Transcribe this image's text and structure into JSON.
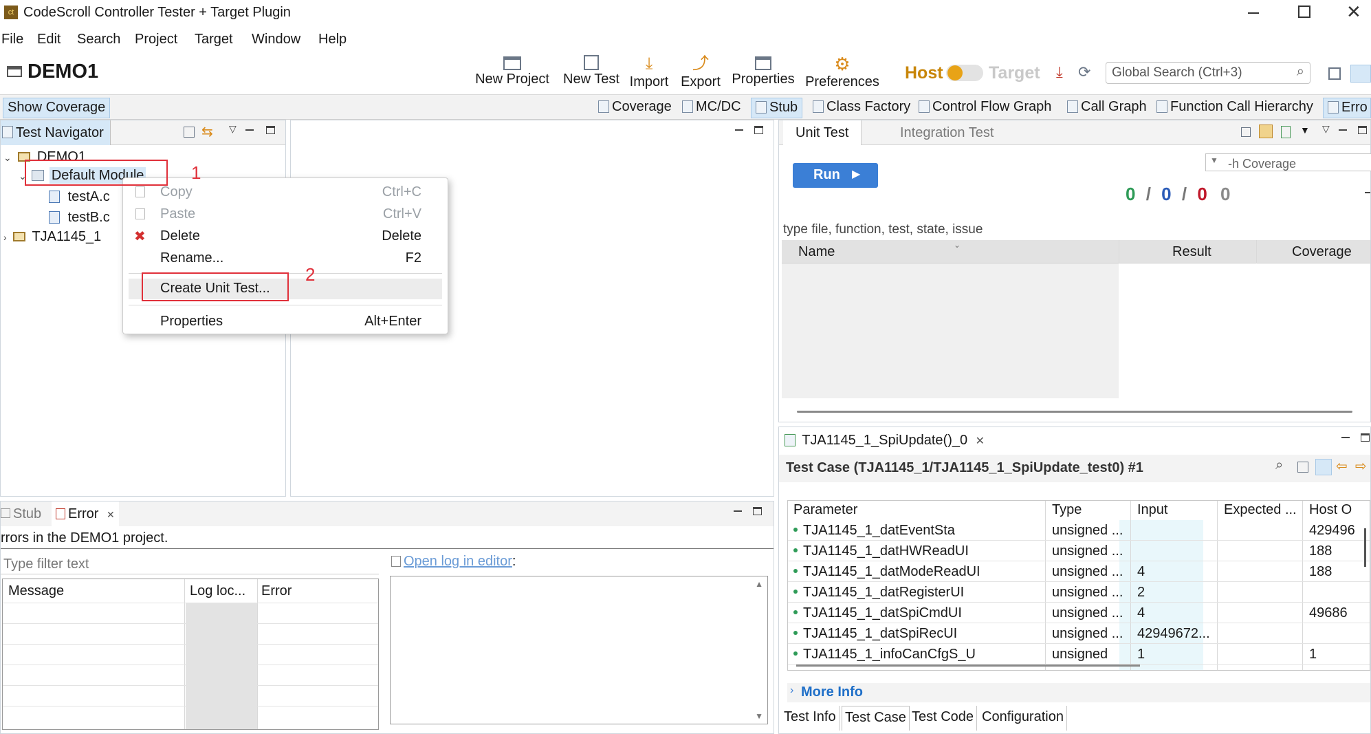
{
  "window": {
    "title": "CodeScroll Controller Tester + Target Plugin",
    "app_icon_text": "ct"
  },
  "menu": [
    "File",
    "Edit",
    "Search",
    "Project",
    "Target",
    "Window",
    "Help"
  ],
  "project_title": "DEMO1",
  "toolbar": {
    "buttons": [
      "New Project",
      "New Test",
      "Import",
      "Export",
      "Properties",
      "Preferences"
    ],
    "host_label": "Host",
    "target_label": "Target",
    "search_placeholder": "Global Search (Ctrl+3)"
  },
  "views_bar": {
    "show_coverage": "Show Coverage",
    "items": [
      "Coverage",
      "MC/DC",
      "Stub",
      "Class Factory",
      "Control Flow Graph",
      "Call Graph",
      "Function Call Hierarchy",
      "Erro"
    ]
  },
  "navigator": {
    "tab_label": "Test Navigator",
    "tree": {
      "root": "DEMO1",
      "module": "Default Module",
      "files": [
        "testA.c",
        "testB.c"
      ],
      "other": "TJA1145_1"
    }
  },
  "context_menu": {
    "items": [
      {
        "label": "Copy",
        "shortcut": "Ctrl+C"
      },
      {
        "label": "Paste",
        "shortcut": "Ctrl+V"
      },
      {
        "label": "Delete",
        "shortcut": "Delete"
      },
      {
        "label": "Rename...",
        "shortcut": "F2"
      },
      {
        "label": "Create Unit Test...",
        "shortcut": ""
      },
      {
        "label": "Properties",
        "shortcut": "Alt+Enter"
      }
    ]
  },
  "annotations": [
    "1",
    "2"
  ],
  "unit_test_panel": {
    "tabs": [
      "Unit Test",
      "Integration Test"
    ],
    "run_label": "Run",
    "coverage_combo": "-h Coverage",
    "counters": [
      "0",
      "/",
      "0",
      "/",
      "0",
      "0"
    ],
    "filter_placeholder": "type file, function, test, state, issue",
    "columns": [
      "Name",
      "Result",
      "Coverage"
    ]
  },
  "error_panel": {
    "tabs": [
      "Stub",
      "Error"
    ],
    "summary": "rrors in the DEMO1 project.",
    "filter_placeholder": "Type filter text",
    "open_log": "Open log in editor",
    "open_log_suffix": ":",
    "columns": [
      "Message",
      "Log loc...",
      "Error"
    ]
  },
  "test_case_panel": {
    "tab_label": "TJA1145_1_SpiUpdate()_0",
    "heading": "Test Case (TJA1145_1/TJA1145_1_SpiUpdate_test0) #1",
    "columns": [
      "Parameter",
      "Type",
      "Input",
      "Expected ...",
      "Host O"
    ],
    "rows": [
      {
        "param": "TJA1145_1_datEventSta",
        "type": "unsigned ...",
        "input": "",
        "expected": "",
        "host": "429496"
      },
      {
        "param": "TJA1145_1_datHWReadUI",
        "type": "unsigned ...",
        "input": "",
        "expected": "",
        "host": "188"
      },
      {
        "param": "TJA1145_1_datModeReadUI",
        "type": "unsigned ...",
        "input": "4",
        "expected": "",
        "host": "188"
      },
      {
        "param": "TJA1145_1_datRegisterUI",
        "type": "unsigned ...",
        "input": "2",
        "expected": "",
        "host": ""
      },
      {
        "param": "TJA1145_1_datSpiCmdUI",
        "type": "unsigned ...",
        "input": "4",
        "expected": "",
        "host": "49686"
      },
      {
        "param": "TJA1145_1_datSpiRecUI",
        "type": "unsigned ...",
        "input": "42949672...",
        "expected": "",
        "host": ""
      },
      {
        "param": "TJA1145_1_infoCanCfgS_U",
        "type": "unsigned",
        "input": "1",
        "expected": "",
        "host": "1"
      }
    ],
    "more_info": "More Info",
    "bottom_tabs": [
      "Test Info",
      "Test Case",
      "Test Code",
      "Configuration"
    ]
  },
  "colors": {
    "accent": "#3b7fd6",
    "annotation_red": "#e0303a",
    "selection_bg": "#d6e8f7",
    "toggle_knob": "#e8a317",
    "host_text": "#c8860a",
    "expected_cell_bg": "#e9f7fb"
  }
}
